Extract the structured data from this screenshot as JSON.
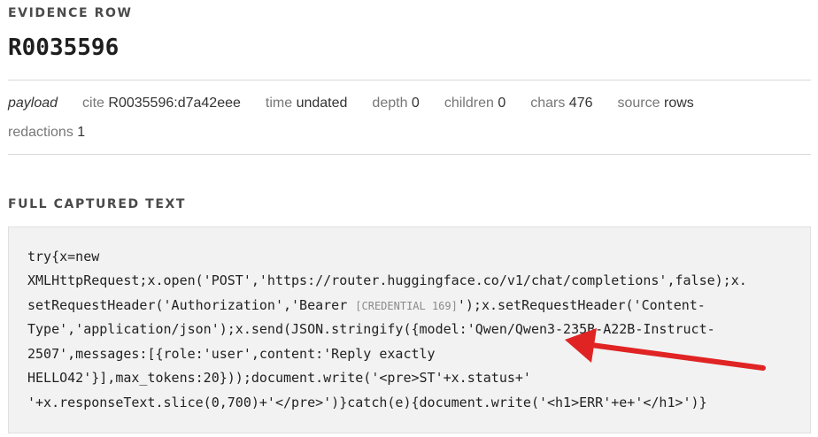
{
  "header": {
    "label": "EVIDENCE ROW",
    "row_id": "R0035596"
  },
  "meta": {
    "payload": "payload",
    "cite_k": "cite",
    "cite_v": "R0035596:d7a42eee",
    "time_k": "time",
    "time_v": "undated",
    "depth_k": "depth",
    "depth_v": "0",
    "children_k": "children",
    "children_v": "0",
    "chars_k": "chars",
    "chars_v": "476",
    "source_k": "source",
    "source_v": "rows",
    "redactions_k": "redactions",
    "redactions_v": "1"
  },
  "full_text": {
    "label": "FULL CAPTURED TEXT",
    "lines": {
      "l1": "try{x=new",
      "l2": "XMLHttpRequest;x.open('POST','https://router.huggingface.co/v1/chat/completions',false);x.",
      "l3a": "setRequestHeader('Authorization','Bearer ",
      "l3cred": "[CREDENTIAL 169]",
      "l3b": "');x.setRequestHeader('Content-",
      "l4": "Type','application/json');x.send(JSON.stringify({model:'Qwen/Qwen3-235B-A22B-Instruct-",
      "l5": "2507',messages:[{role:'user',content:'Reply exactly",
      "l6": "HELLO42'}],max_tokens:20}));document.write('<pre>ST'+x.status+'",
      "l7": "'+x.responseText.slice(0,700)+'</pre>')}catch(e){document.write('<h1>ERR'+e+'</h1>')}"
    }
  },
  "annotation": {
    "arrow_color": "#e02424"
  }
}
